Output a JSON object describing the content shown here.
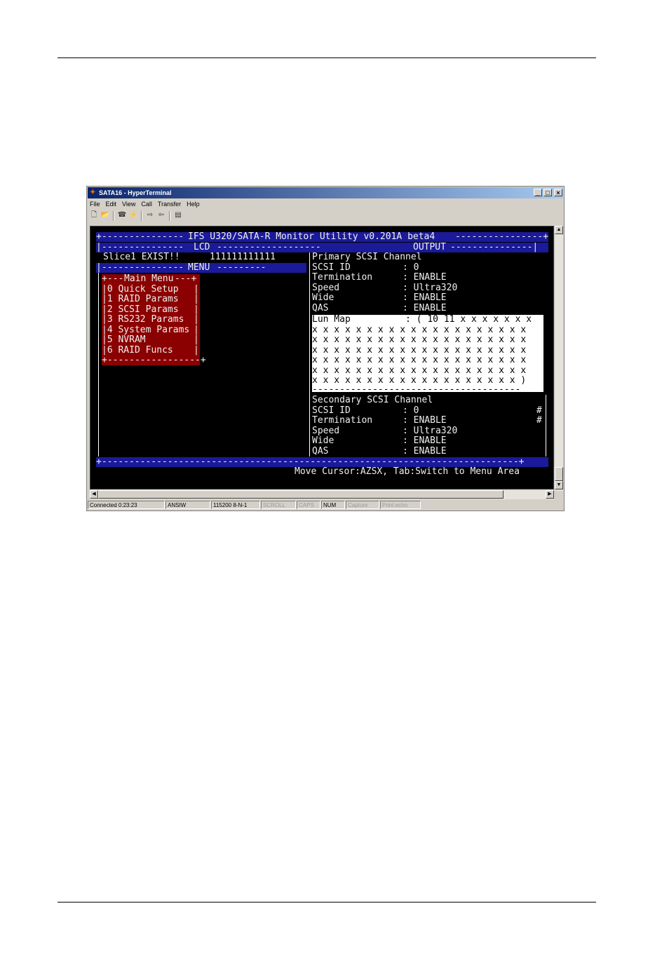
{
  "window": {
    "title": "SATA16 - HyperTerminal",
    "min_label": "_",
    "max_label": "□",
    "close_label": "×"
  },
  "menubar": [
    "File",
    "Edit",
    "View",
    "Call",
    "Transfer",
    "Help"
  ],
  "toolbar_icons": [
    "new-icon",
    "open-icon",
    "phone-icon",
    "disconnect-icon",
    "send-icon",
    "receive-icon",
    "properties-icon"
  ],
  "terminal": {
    "header_title": "IFS U320/SATA-R Monitor Utility v0.201A beta4",
    "lcd_label": "LCD",
    "output_label": "OUTPUT",
    "menu_label": "MENU",
    "lcd_text": "Slice1 EXIST!!",
    "lcd_bits": "111111111111",
    "main_menu_title": "Main Menu",
    "menu_items": [
      "0 Quick Setup",
      "1 RAID Params",
      "2 SCSI Params",
      "3 RS232 Params",
      "4 System Params",
      "5 NVRAM",
      "6 RAID Funcs"
    ],
    "primary": {
      "title": "Primary SCSI Channel",
      "rows": [
        {
          "key": "SCSI ID",
          "value": "0"
        },
        {
          "key": "Termination",
          "value": "ENABLE"
        },
        {
          "key": "Speed",
          "value": "Ultra320"
        },
        {
          "key": "Wide",
          "value": "ENABLE"
        },
        {
          "key": "QAS",
          "value": "ENABLE"
        }
      ],
      "lun_label": "Lun Map",
      "lun_lines": [
        "Lun Map          : ( 10 11 x x x x x x x",
        "x x x x x x x x x x x x x x x x x x x x",
        "x x x x x x x x x x x x x x x x x x x x",
        "x x x x x x x x x x x x x x x x x x x x",
        "x x x x x x x x x x x x x x x x x x x x",
        "x x x x x x x x x x x x x x x x x x x x",
        "x x x x x x x x x x x x x x x x x x x )"
      ]
    },
    "secondary": {
      "title": "Secondary SCSI Channel",
      "rows": [
        {
          "key": "SCSI ID",
          "value": "0"
        },
        {
          "key": "Termination",
          "value": "ENABLE"
        },
        {
          "key": "Speed",
          "value": "Ultra320"
        },
        {
          "key": "Wide",
          "value": "ENABLE"
        },
        {
          "key": "QAS",
          "value": "ENABLE"
        }
      ]
    },
    "help_text": "Move Cursor:AZSX, Tab:Switch to Menu Area"
  },
  "statusbar": {
    "connected": "Connected 0:23:23",
    "emulation": "ANSIW",
    "settings": "115200 8-N-1",
    "scroll": "SCROLL",
    "caps": "CAPS",
    "num": "NUM",
    "capture": "Capture",
    "print_echo": "Print echo"
  },
  "colors": {
    "header_blue": "#1a1a9a",
    "menu_red": "#8b0000",
    "terminal_bg": "#000000"
  }
}
